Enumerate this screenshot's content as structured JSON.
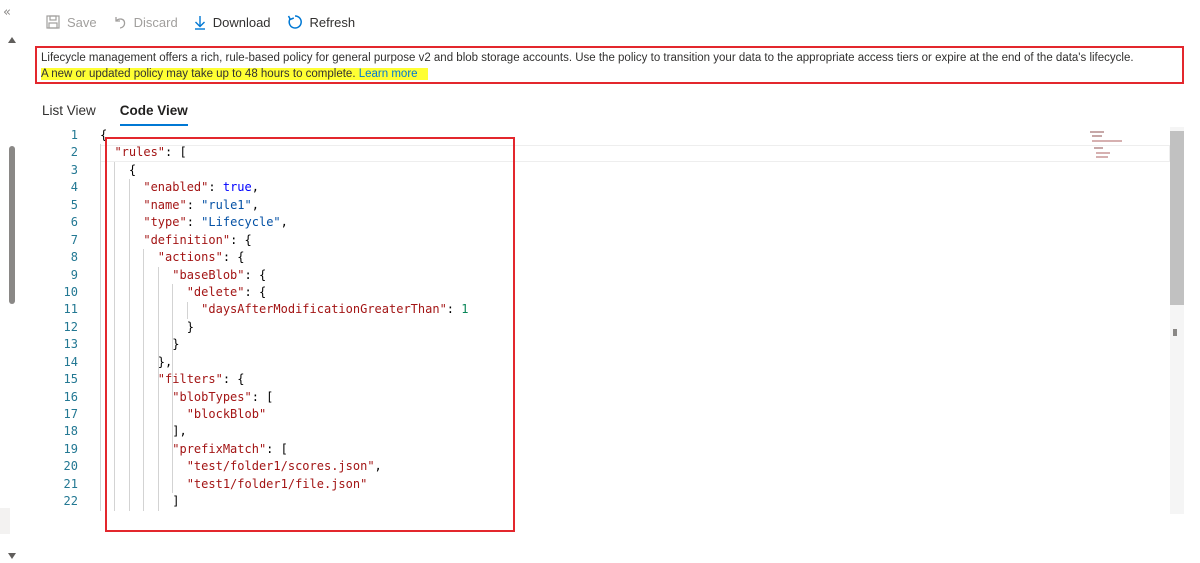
{
  "toolbar": {
    "collapse_glyph": "«",
    "save_label": "Save",
    "discard_label": "Discard",
    "download_label": "Download",
    "refresh_label": "Refresh"
  },
  "notice": {
    "line1": "Lifecycle management offers a rich, rule-based policy for general purpose v2 and blob storage accounts. Use the policy to transition your data to the appropriate access tiers or expire at the end of the data's lifecycle.",
    "line2": "A new or updated policy may take up to 48 hours to complete.",
    "link_label": "Learn more"
  },
  "tabs": [
    {
      "label": "List View",
      "active": false
    },
    {
      "label": "Code View",
      "active": true
    }
  ],
  "code_lines": [
    {
      "n": "1",
      "indent": 0,
      "parts": [
        [
          "p",
          "{"
        ]
      ]
    },
    {
      "n": "2",
      "indent": 2,
      "parts": [
        [
          "k",
          "\"rules\""
        ],
        [
          "p",
          ": ["
        ]
      ]
    },
    {
      "n": "3",
      "indent": 4,
      "parts": [
        [
          "p",
          "{"
        ]
      ]
    },
    {
      "n": "4",
      "indent": 6,
      "parts": [
        [
          "k",
          "\"enabled\""
        ],
        [
          "p",
          ": "
        ],
        [
          "b",
          "true"
        ],
        [
          "p",
          ","
        ]
      ]
    },
    {
      "n": "5",
      "indent": 6,
      "parts": [
        [
          "k",
          "\"name\""
        ],
        [
          "p",
          ": "
        ],
        [
          "s",
          "\"rule1\""
        ],
        [
          "p",
          ","
        ]
      ]
    },
    {
      "n": "6",
      "indent": 6,
      "parts": [
        [
          "k",
          "\"type\""
        ],
        [
          "p",
          ": "
        ],
        [
          "s",
          "\"Lifecycle\""
        ],
        [
          "p",
          ","
        ]
      ]
    },
    {
      "n": "7",
      "indent": 6,
      "parts": [
        [
          "k",
          "\"definition\""
        ],
        [
          "p",
          ": {"
        ]
      ]
    },
    {
      "n": "8",
      "indent": 8,
      "parts": [
        [
          "k",
          "\"actions\""
        ],
        [
          "p",
          ": {"
        ]
      ]
    },
    {
      "n": "9",
      "indent": 10,
      "parts": [
        [
          "k",
          "\"baseBlob\""
        ],
        [
          "p",
          ": {"
        ]
      ]
    },
    {
      "n": "10",
      "indent": 12,
      "parts": [
        [
          "k",
          "\"delete\""
        ],
        [
          "p",
          ": {"
        ]
      ]
    },
    {
      "n": "11",
      "indent": 14,
      "parts": [
        [
          "k",
          "\"daysAfterModificationGreaterThan\""
        ],
        [
          "p",
          ": "
        ],
        [
          "n",
          "1"
        ]
      ]
    },
    {
      "n": "12",
      "indent": 12,
      "parts": [
        [
          "p",
          "}"
        ]
      ]
    },
    {
      "n": "13",
      "indent": 10,
      "parts": [
        [
          "p",
          "}"
        ]
      ]
    },
    {
      "n": "14",
      "indent": 8,
      "parts": [
        [
          "p",
          "},"
        ]
      ]
    },
    {
      "n": "15",
      "indent": 8,
      "parts": [
        [
          "k",
          "\"filters\""
        ],
        [
          "p",
          ": {"
        ]
      ]
    },
    {
      "n": "16",
      "indent": 10,
      "parts": [
        [
          "k",
          "\"blobTypes\""
        ],
        [
          "p",
          ": ["
        ]
      ]
    },
    {
      "n": "17",
      "indent": 12,
      "parts": [
        [
          "k",
          "\"blockBlob\""
        ]
      ]
    },
    {
      "n": "18",
      "indent": 10,
      "parts": [
        [
          "p",
          "],"
        ]
      ]
    },
    {
      "n": "19",
      "indent": 10,
      "parts": [
        [
          "k",
          "\"prefixMatch\""
        ],
        [
          "p",
          ": ["
        ]
      ]
    },
    {
      "n": "20",
      "indent": 12,
      "parts": [
        [
          "k",
          "\"test/folder1/scores.json\""
        ],
        [
          "p",
          ","
        ]
      ]
    },
    {
      "n": "21",
      "indent": 12,
      "parts": [
        [
          "k",
          "\"test1/folder1/file.json\""
        ]
      ]
    },
    {
      "n": "22",
      "indent": 10,
      "parts": [
        [
          "p",
          "]"
        ]
      ]
    }
  ],
  "colors": {
    "accent": "#0078d4",
    "highlight_box": "#e3272d",
    "notice_highlight": "#ffff33",
    "json_key": "#a31515",
    "json_string": "#0451a5",
    "json_bool": "#0000ff",
    "json_number": "#098658",
    "line_number": "#237893"
  }
}
